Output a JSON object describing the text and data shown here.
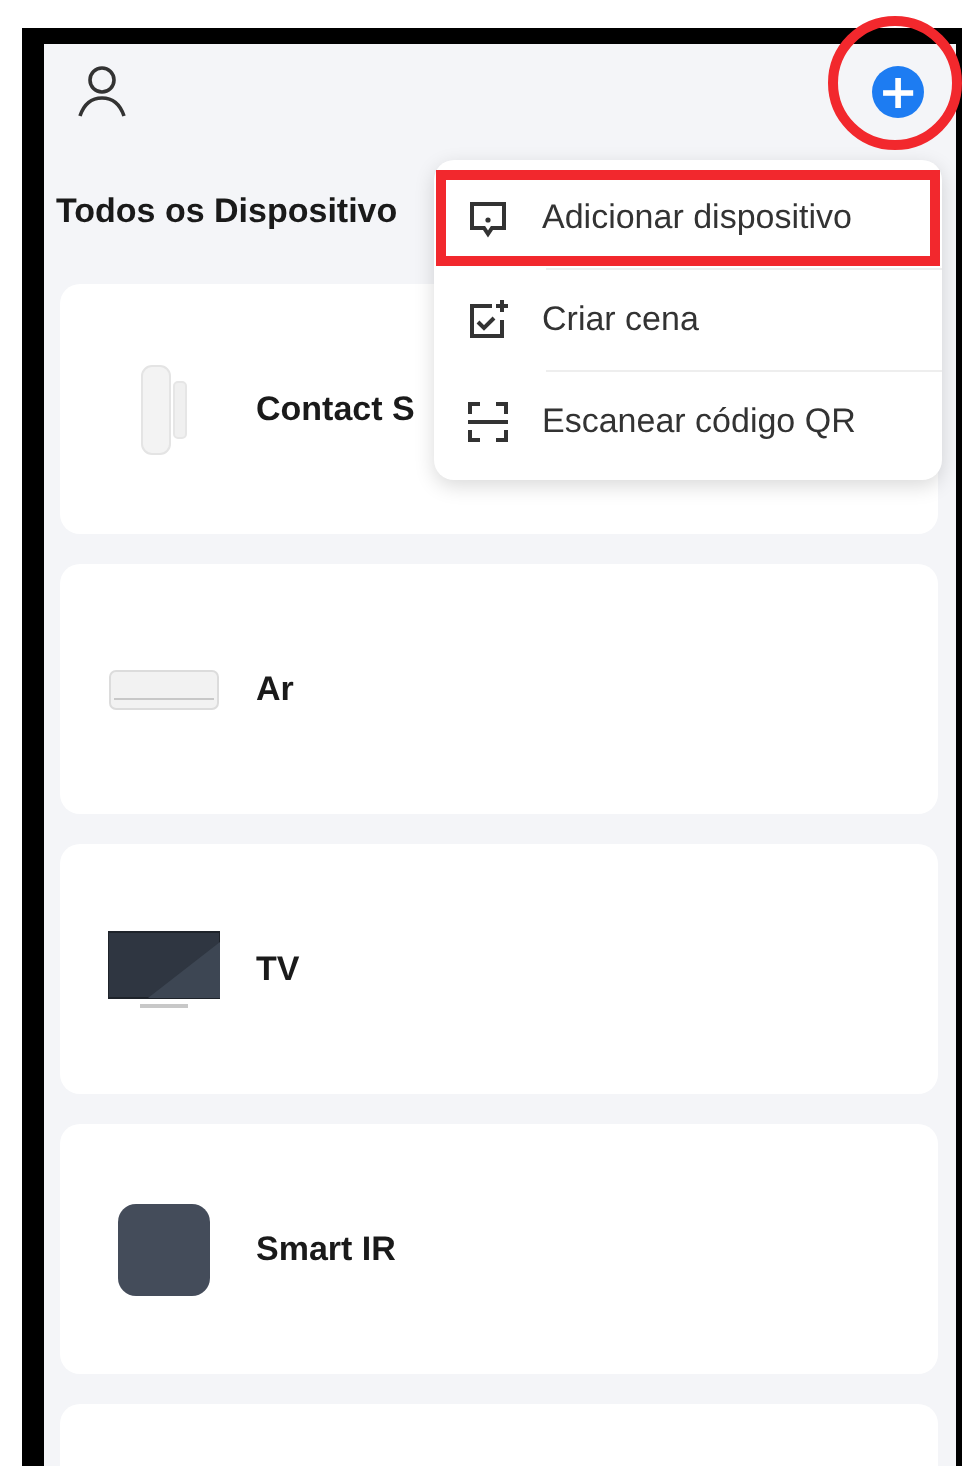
{
  "header": {
    "add_button": {
      "label": "+",
      "highlighted": true
    }
  },
  "title": "Todos os Dispositivo",
  "devices": [
    {
      "name": "Contact S",
      "kind": "sensor"
    },
    {
      "name": "Ar",
      "kind": "ac"
    },
    {
      "name": "TV",
      "kind": "tv"
    },
    {
      "name": "Smart IR",
      "kind": "hub"
    }
  ],
  "menu": [
    {
      "label": "Adicionar dispositivo",
      "kind": "add-device",
      "highlighted": true
    },
    {
      "label": "Criar cena",
      "kind": "scene",
      "highlighted": false
    },
    {
      "label": "Escanear código QR",
      "kind": "scan",
      "highlighted": false
    }
  ]
}
